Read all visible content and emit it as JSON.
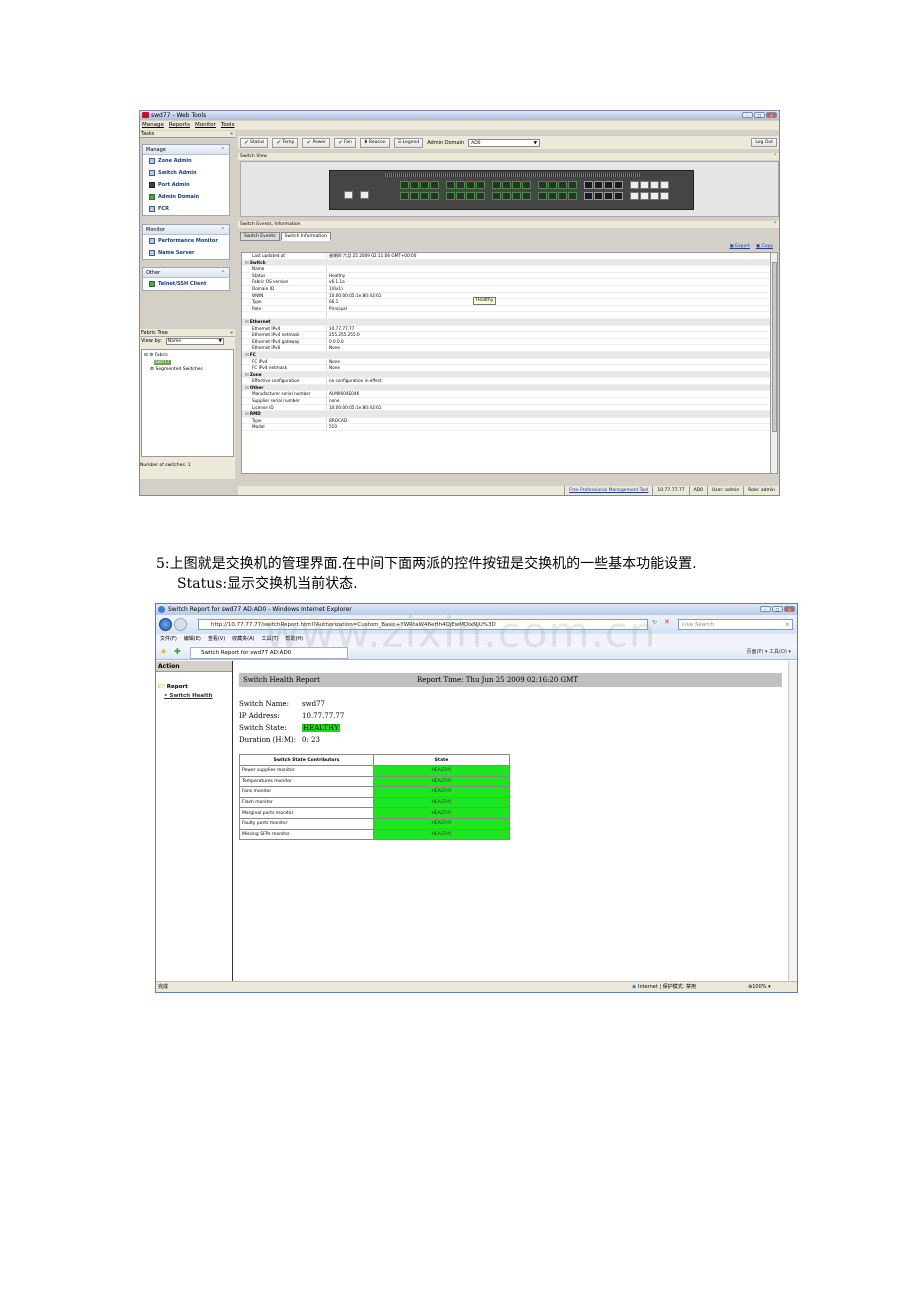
{
  "webtools": {
    "title": "swd77 - Web Tools",
    "menu": [
      "Manage",
      "Reports",
      "Monitor",
      "Tools"
    ],
    "tasks_label": "Tasks",
    "manage_panel": {
      "label": "Manage",
      "items": [
        "Zone Admin",
        "Switch Admin",
        "Port Admin",
        "Admin Domain",
        "FCR"
      ]
    },
    "monitor_panel": {
      "label": "Monitor",
      "items": [
        "Performance Monitor",
        "Name Server"
      ]
    },
    "other_panel": {
      "label": "Other",
      "items": [
        "Telnet/SSH Client"
      ]
    },
    "fabric_tree": {
      "label": "Fabric Tree",
      "view_by_label": "View by:",
      "view_by_value": "Name",
      "fabric": "Fabric",
      "switch": "swd77",
      "segmented": "Segmented Switches",
      "count": "Number of switches:  1"
    },
    "toolbar": {
      "status": "Status",
      "temp": "Temp",
      "power": "Power",
      "fan": "Fan",
      "beacon": "Beacon",
      "legend": "Legend",
      "admin_domain_label": "Admin Domain",
      "admin_domain_value": "AD0",
      "logout": "Log Out"
    },
    "switch_view_label": "Switch View",
    "events_label": "Switch Events, Information",
    "tabs": [
      "Switch Events",
      "Switch Information"
    ],
    "export": "Export",
    "copy": "Copy",
    "tooltip": "Healthy",
    "rows": [
      {
        "k": "Last updated at",
        "v": "星期四 六月 25 2009 02:11:06 GMT+00:00"
      },
      {
        "k": "Switch",
        "v": "",
        "g": true
      },
      {
        "k": "Name",
        "v": ""
      },
      {
        "k": "Status",
        "v": "Healthy"
      },
      {
        "k": "Fabric OS version",
        "v": "v6.1.1a"
      },
      {
        "k": "Domain ID",
        "v": "1(0x1)"
      },
      {
        "k": "WWN",
        "v": "10:00:00:05:1e:80:43:61"
      },
      {
        "k": "Type",
        "v": "66.1"
      },
      {
        "k": "Role",
        "v": "Principal"
      },
      {
        "k": "",
        "v": ""
      },
      {
        "k": "Ethernet",
        "v": "",
        "g": true
      },
      {
        "k": "Ethernet IPv4",
        "v": "10.77.77.77"
      },
      {
        "k": "Ethernet IPv4 netmask",
        "v": "255.255.255.0"
      },
      {
        "k": "Ethernet IPv4 gateway",
        "v": "0.0.0.0"
      },
      {
        "k": "Ethernet IPv6",
        "v": "None"
      },
      {
        "k": "FC",
        "v": "",
        "g": true
      },
      {
        "k": "FC IPv4",
        "v": "None"
      },
      {
        "k": "FC IPv4 netmask",
        "v": "None"
      },
      {
        "k": "Zone",
        "v": "",
        "g": true
      },
      {
        "k": "Effective configuration",
        "v": "no configuration in effect"
      },
      {
        "k": "Other",
        "v": "",
        "g": true
      },
      {
        "k": "Manufacturer serial number",
        "v": "ALM0604E04K"
      },
      {
        "k": "Supplier serial number",
        "v": "none"
      },
      {
        "k": "License ID",
        "v": "10:00:00:05:1e:80:43:61"
      },
      {
        "k": "RMD",
        "v": "",
        "g": true
      },
      {
        "k": "Type",
        "v": "BROCAD"
      },
      {
        "k": "Model",
        "v": "510"
      }
    ],
    "status_bar": [
      "Free Professional Management Tool",
      "10.77.77.77",
      "AD0",
      "User: admin",
      "Role: admin"
    ]
  },
  "para1": "5:上图就是交换机的管理界面.在中间下面两派的控件按钮是交换机的一些基本功能设置.",
  "para2": "Status:显示交换机当前状态.",
  "watermark": "www.zixin.com.cn",
  "ie": {
    "title": "Switch Report for swd77 AD:AD0 - Windows Internet Explorer",
    "url": "http://10.77.77.77/switchReport.html?Authorization=Custom_Basic+YWRtaW46eHh4OjEwMDIxNjU%3D",
    "search_placeholder": "Live Search",
    "menu": [
      "文件(F)",
      "编辑(E)",
      "查看(V)",
      "收藏夹(A)",
      "工具(T)",
      "帮助(H)"
    ],
    "tab": "Switch Report for swd77 AD:AD0",
    "tools": "页面(P) ▾  工具(O) ▾",
    "action_label": "Action",
    "report_label": "Report",
    "switch_health_link": "Switch Health",
    "report_title": "Switch Health Report",
    "report_time": "Report Time: Thu Jun 25 2009 02:16:20 GMT",
    "fields": [
      {
        "k": "Switch Name:",
        "v": "swd77"
      },
      {
        "k": "IP Address:",
        "v": "10.77.77.77"
      },
      {
        "k": "Switch State:",
        "v": "HEALTHY"
      },
      {
        "k": "Duration (H:M):",
        "v": "0: 23"
      }
    ],
    "table_headers": [
      "Switch State Contributors",
      "State"
    ],
    "table_rows": [
      {
        "c": "Power supplies monitor",
        "s": "HEALTHY"
      },
      {
        "c": "Temperatures monitor",
        "s": "HEALTHY"
      },
      {
        "c": "Fans monitor",
        "s": "HEALTHY"
      },
      {
        "c": "Flash monitor",
        "s": "HEALTHY"
      },
      {
        "c": "Marginal ports monitor",
        "s": "HEALTHY"
      },
      {
        "c": "Faulty ports monitor",
        "s": "HEALTHY"
      },
      {
        "c": "Missing SFPs monitor",
        "s": "HEALTHY"
      }
    ],
    "status_done": "完成",
    "status_zone": "Internet | 保护模式: 禁用",
    "zoom": "100%"
  }
}
